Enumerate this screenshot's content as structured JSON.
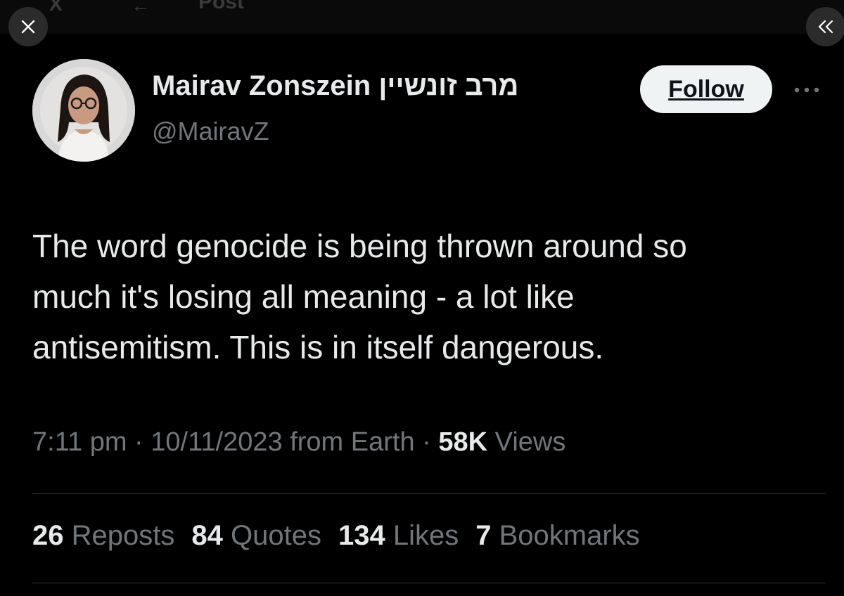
{
  "header": {
    "title": "Post",
    "back_symbol": "←",
    "logo_text": "X"
  },
  "overlay": {
    "close_icon": "close-icon",
    "collapse_icon": "double-chevron-left-icon"
  },
  "author": {
    "display_name": "Mairav Zonszein מרב זונשיין",
    "handle": "@MairavZ",
    "avatar_icon": "avatar-photo"
  },
  "actions": {
    "follow_label": "Follow",
    "more_icon": "more-horizontal-icon"
  },
  "tweet": {
    "lines": [
      "The word genocide is being thrown around so",
      "much it's losing all meaning - a lot like",
      "antisemitism. This is in itself dangerous."
    ]
  },
  "meta": {
    "time": "7:11 pm",
    "separator": "·",
    "date": "10/11/2023",
    "source": "from Earth",
    "views_count": "58K",
    "views_label": "Views"
  },
  "stats": {
    "reposts_count": "26",
    "reposts_label": "Reposts",
    "quotes_count": "84",
    "quotes_label": "Quotes",
    "likes_count": "134",
    "likes_label": "Likes",
    "bookmarks_count": "7",
    "bookmarks_label": "Bookmarks"
  },
  "colors": {
    "background": "#000000",
    "primary_text": "#e7e9ea",
    "secondary_text": "#71767b",
    "follow_bg": "#eff3f4",
    "divider": "#2f3336"
  }
}
